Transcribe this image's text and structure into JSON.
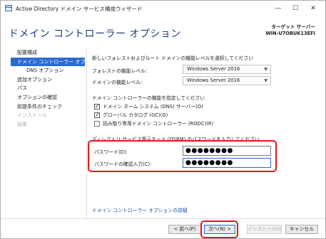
{
  "window": {
    "title": "Active Directory ドメイン サービス構成ウィザード",
    "controls": {
      "minimize": "—",
      "maximize": "☐",
      "close": "✕"
    }
  },
  "header": {
    "page_title": "ドメイン コントローラー オプション",
    "target_label": "ターゲット サーバー",
    "target_name": "WIN-U7OBUK13EFI"
  },
  "sidebar": {
    "items": [
      {
        "label": "配置構成",
        "state": "normal"
      },
      {
        "label": "ドメイン コントローラー オプ...",
        "state": "active"
      },
      {
        "label": "DNS オプション",
        "state": "sub"
      },
      {
        "label": "追加オプション",
        "state": "normal"
      },
      {
        "label": "パス",
        "state": "normal"
      },
      {
        "label": "オプションの確認",
        "state": "normal"
      },
      {
        "label": "前提条件のチェック",
        "state": "normal"
      },
      {
        "label": "インストール",
        "state": "disabled"
      },
      {
        "label": "結果",
        "state": "disabled"
      }
    ]
  },
  "main": {
    "functional_level_heading": "新しいフォレストおよびルート ドメインの機能レベルを選択してください",
    "forest_level_label": "フォレストの機能レベル:",
    "forest_level_value": "Windows Server 2016",
    "domain_level_label": "ドメインの機能レベル:",
    "domain_level_value": "Windows Server 2016",
    "capabilities_heading": "ドメイン コントローラーの機能を指定してください",
    "capabilities": [
      {
        "label": "ドメイン ネーム システム (DNS) サーバー(O)",
        "checked": true
      },
      {
        "label": "グローバル カタログ (GC)(G)",
        "checked": true
      },
      {
        "label": "読み取り専用ドメイン コントローラー (RODC)(R)",
        "checked": false
      }
    ],
    "dsrm_heading": "ディレクトリ サービス復元モード (DSRM) のパスワードを入力してください",
    "password_label": "パスワード(D):",
    "password_value": "●●●●●●●●",
    "confirm_label": "パスワードの確認入力(C):",
    "confirm_value": "●●●●●●●●",
    "details_link": "ドメイン コントローラー オプションの詳細"
  },
  "buttons": {
    "back": "< 前へ(P)",
    "next": "次へ(N) >",
    "install": "インストール(I)",
    "cancel": "キャンセル"
  },
  "colors": {
    "accent": "#2b6ad3",
    "title": "#1b3f7a",
    "highlight": "#e2181c",
    "link": "#1a4fa6"
  }
}
